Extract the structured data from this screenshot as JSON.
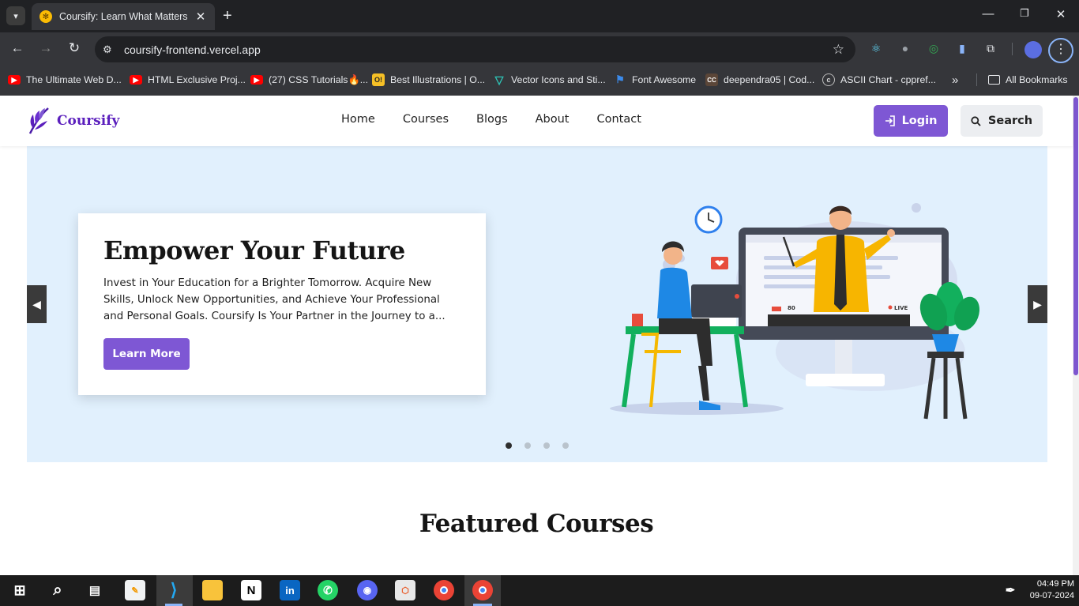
{
  "browser": {
    "tab_title": "Coursify: Learn What Matters",
    "url": "coursify-frontend.vercel.app",
    "bookmarks": [
      {
        "label": "The Ultimate Web D...",
        "icon": "youtube-icon"
      },
      {
        "label": "HTML Exclusive Proj...",
        "icon": "youtube-icon"
      },
      {
        "label": "(27) CSS Tutorials🔥...",
        "icon": "youtube-icon"
      },
      {
        "label": "Best Illustrations | O...",
        "icon": "ouch-icon"
      },
      {
        "label": "Vector Icons and Sti...",
        "icon": "flaticon-icon"
      },
      {
        "label": "Font Awesome",
        "icon": "font-awesome-icon"
      },
      {
        "label": "deependra05 | Cod...",
        "icon": "codechef-icon"
      },
      {
        "label": "ASCII Chart - cppref...",
        "icon": "cppreference-icon"
      }
    ],
    "all_bookmarks": "All Bookmarks"
  },
  "site": {
    "brand": "Coursify",
    "nav": [
      "Home",
      "Courses",
      "Blogs",
      "About",
      "Contact"
    ],
    "login": "Login",
    "search": "Search"
  },
  "hero": {
    "title": "Empower Your Future",
    "text": "Invest in Your Education for a Brighter Tomorrow. Acquire New Skills, Unlock New Opportunities, and Achieve Your Professional and Personal Goals. Coursify Is Your Partner in the Journey to a...",
    "cta": "Learn More",
    "slides": 4,
    "active_slide": 1,
    "screen_count": "80",
    "screen_live": "LIVE"
  },
  "section": {
    "featured_title": "Featured Courses"
  },
  "taskbar": {
    "time": "04:49 PM",
    "date": "09-07-2024"
  },
  "colors": {
    "accent": "#7e57d4",
    "brand": "#5b1fbd",
    "hero_bg": "#e1f0fd"
  }
}
